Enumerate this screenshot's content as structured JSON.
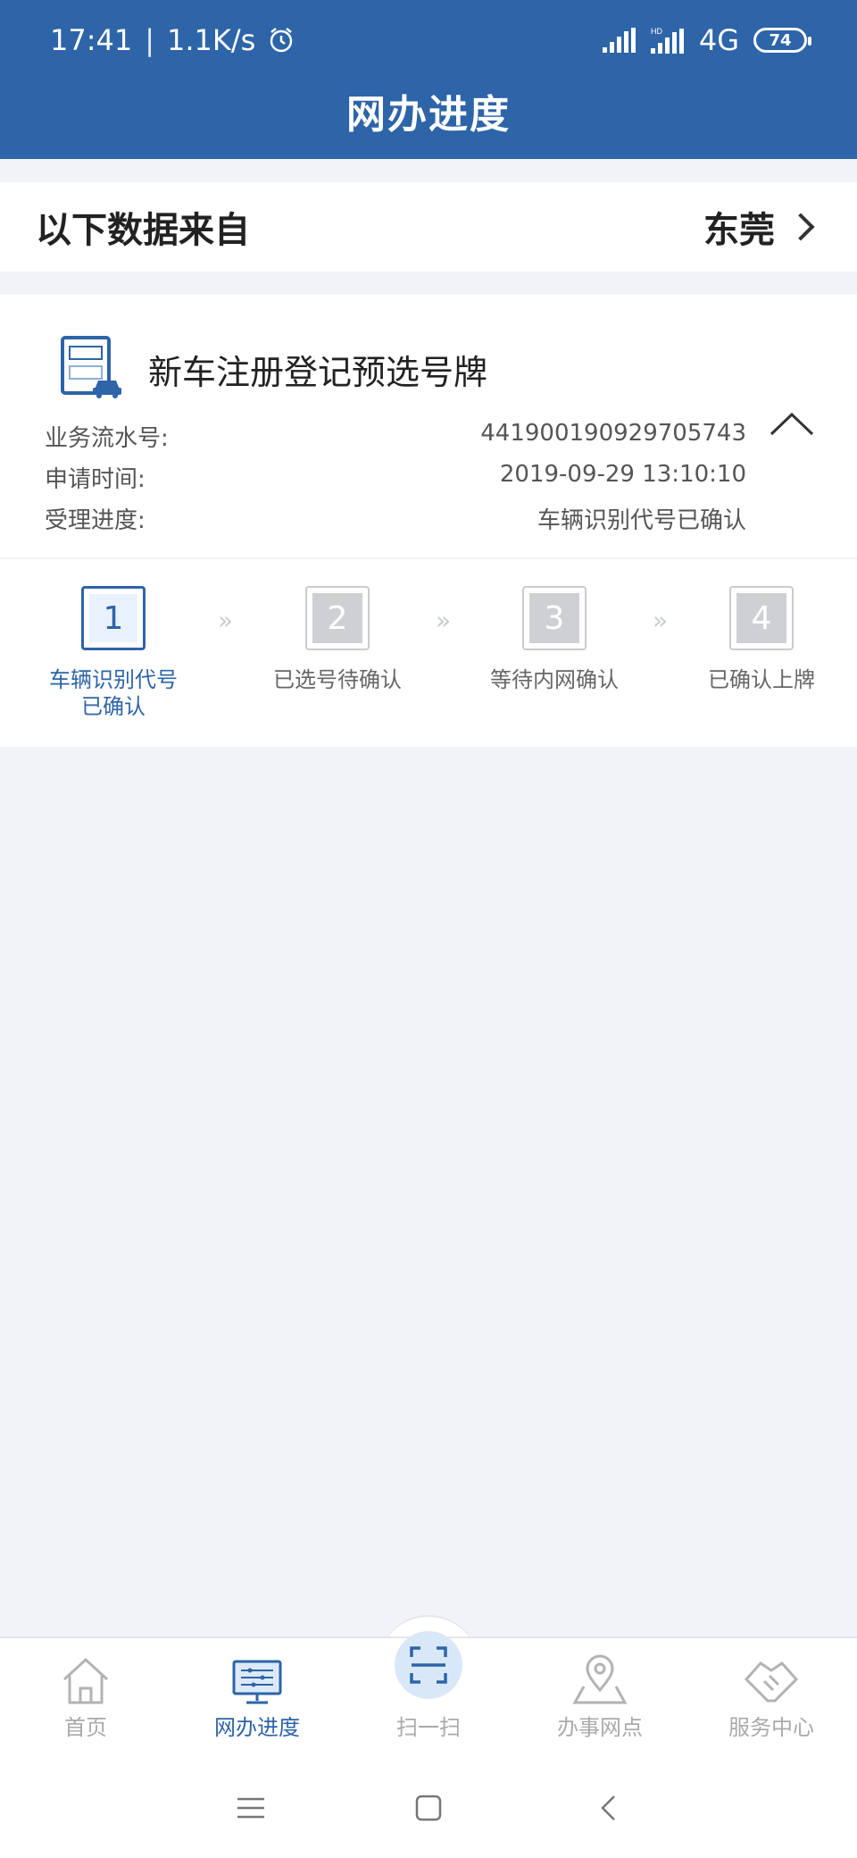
{
  "status_bar": {
    "time": "17:41",
    "net_speed": "1.1K/s",
    "network": "4G",
    "battery": "74"
  },
  "header": {
    "title": "网办进度"
  },
  "source": {
    "label": "以下数据来自",
    "city": "东莞"
  },
  "business": {
    "title": "新车注册登记预选号牌",
    "rows": [
      {
        "label": "业务流水号:",
        "value": "441900190929705743"
      },
      {
        "label": "申请时间:",
        "value": "2019-09-29 13:10:10"
      },
      {
        "label": "受理进度:",
        "value": "车辆识别代号已确认"
      }
    ]
  },
  "steps": [
    {
      "num": "1",
      "label_line1": "车辆识别代号",
      "label_line2": "已确认",
      "active": true
    },
    {
      "num": "2",
      "label_line1": "已选号待确认",
      "label_line2": "",
      "active": false
    },
    {
      "num": "3",
      "label_line1": "等待内网确认",
      "label_line2": "",
      "active": false
    },
    {
      "num": "4",
      "label_line1": "已确认上牌",
      "label_line2": "",
      "active": false
    }
  ],
  "step_arrow": "»",
  "tabs": [
    {
      "label": "首页",
      "icon": "home-icon"
    },
    {
      "label": "网办进度",
      "icon": "monitor-icon",
      "active": true
    },
    {
      "label": "扫一扫",
      "icon": "scan-icon"
    },
    {
      "label": "办事网点",
      "icon": "location-pin-icon"
    },
    {
      "label": "服务中心",
      "icon": "handshake-icon"
    }
  ],
  "colors": {
    "primary": "#2e64a8",
    "background": "#f2f3f8",
    "inactive": "#aaaaaa"
  }
}
